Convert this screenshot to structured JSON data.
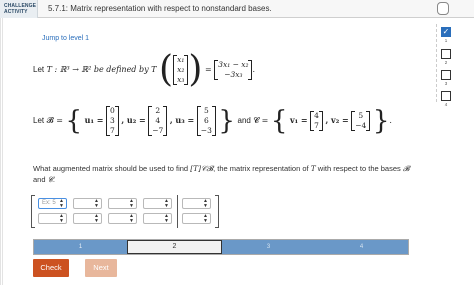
{
  "header": {
    "badge_line1": "CHALLENGE",
    "badge_line2": "ACTIVITY",
    "title": "5.7.1: Matrix representation with respect to nonstandard bases."
  },
  "jump_link": "Jump to level 1",
  "levels": [
    "1",
    "2",
    "3",
    "4"
  ],
  "definition": {
    "lead": "Let",
    "T": "T : ℝ³ → ℝ² be defined by T",
    "x_vector": [
      "x₁",
      "x₂",
      "x₃"
    ],
    "equals": "=",
    "result_vector": [
      "3x₁ − x₂",
      "−3x₃"
    ],
    "end": "."
  },
  "bases": {
    "lead": "Let",
    "B_name": "𝓑 =",
    "u1_label": "u₁ =",
    "u1": [
      "0",
      "3",
      "7"
    ],
    "u2_label": ", u₂ =",
    "u2": [
      "2",
      "4",
      "−7"
    ],
    "u3_label": ", u₃ =",
    "u3": [
      "5",
      "6",
      "−3"
    ],
    "and": "and",
    "C_name": "𝓒 =",
    "v1_label": "v₁ =",
    "v1": [
      "4",
      "7"
    ],
    "v2_label": ", v₂ =",
    "v2": [
      "5",
      "−4"
    ]
  },
  "question": {
    "part1": "What augmented matrix should be used to find",
    "part2": ", the matrix representation of",
    "T": "T",
    "part3": "with respect to the bases",
    "B": "𝓑",
    "and": "and",
    "C": "𝓒",
    "notation": "[T]𝒞𝓑"
  },
  "matrix_input": {
    "first_placeholder": "Ex: 5"
  },
  "progress": {
    "segments": [
      "1",
      "2",
      "3",
      "4"
    ],
    "active": "2"
  },
  "buttons": {
    "check": "Check",
    "next": "Next"
  },
  "colors": {
    "accent": "#2a6ebb",
    "check_button": "#cc5221",
    "next_button_disabled": "#e8b79c",
    "progress_fill": "#6a98c8"
  }
}
